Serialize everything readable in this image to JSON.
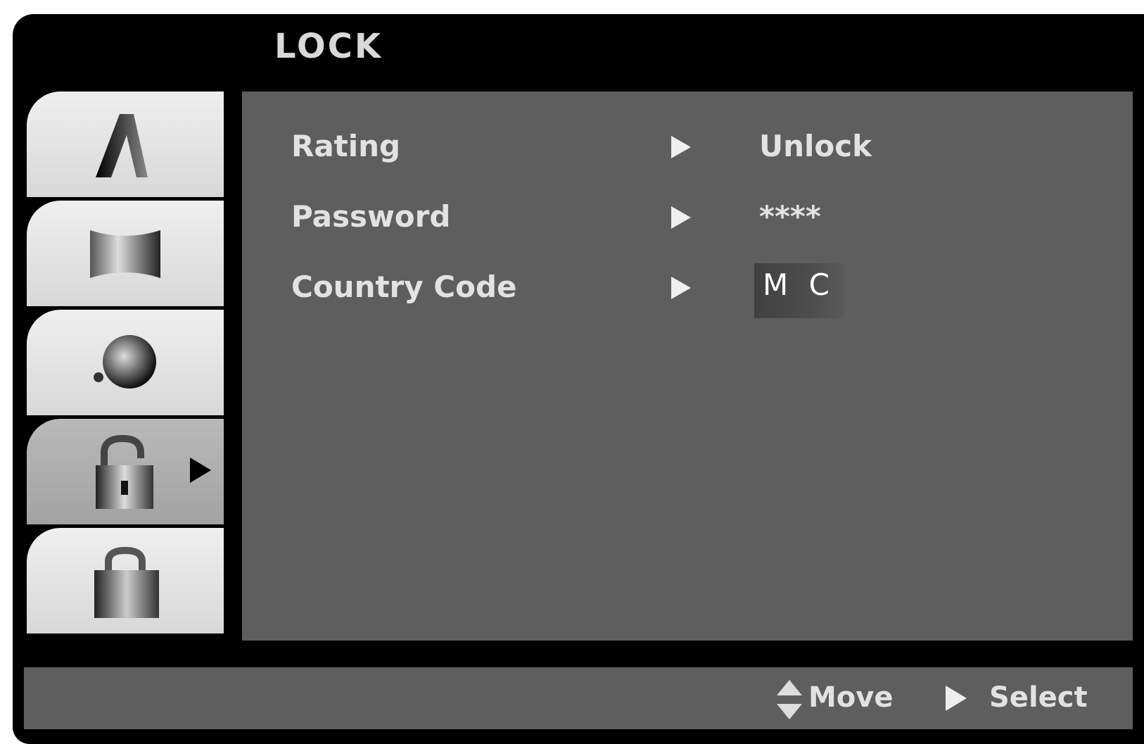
{
  "menu": {
    "title": "LOCK",
    "tabs": [
      {
        "icon": "language-icon",
        "active": false
      },
      {
        "icon": "display-icon",
        "active": false
      },
      {
        "icon": "audio-icon",
        "active": false
      },
      {
        "icon": "lock-icon",
        "active": true
      },
      {
        "icon": "others-icon",
        "active": false
      }
    ]
  },
  "settings": [
    {
      "label": "Rating",
      "value": "Unlock"
    },
    {
      "label": "Password",
      "value": "****"
    },
    {
      "label": "Country Code",
      "value": "M C"
    }
  ],
  "footer": {
    "move_label": "Move",
    "select_label": "Select"
  },
  "colors": {
    "background": "#000000",
    "panel": "#5e5e5e",
    "tab": "#e6e6e6",
    "tab_active": "#aaaaaa",
    "text": "#e2e2e2"
  }
}
